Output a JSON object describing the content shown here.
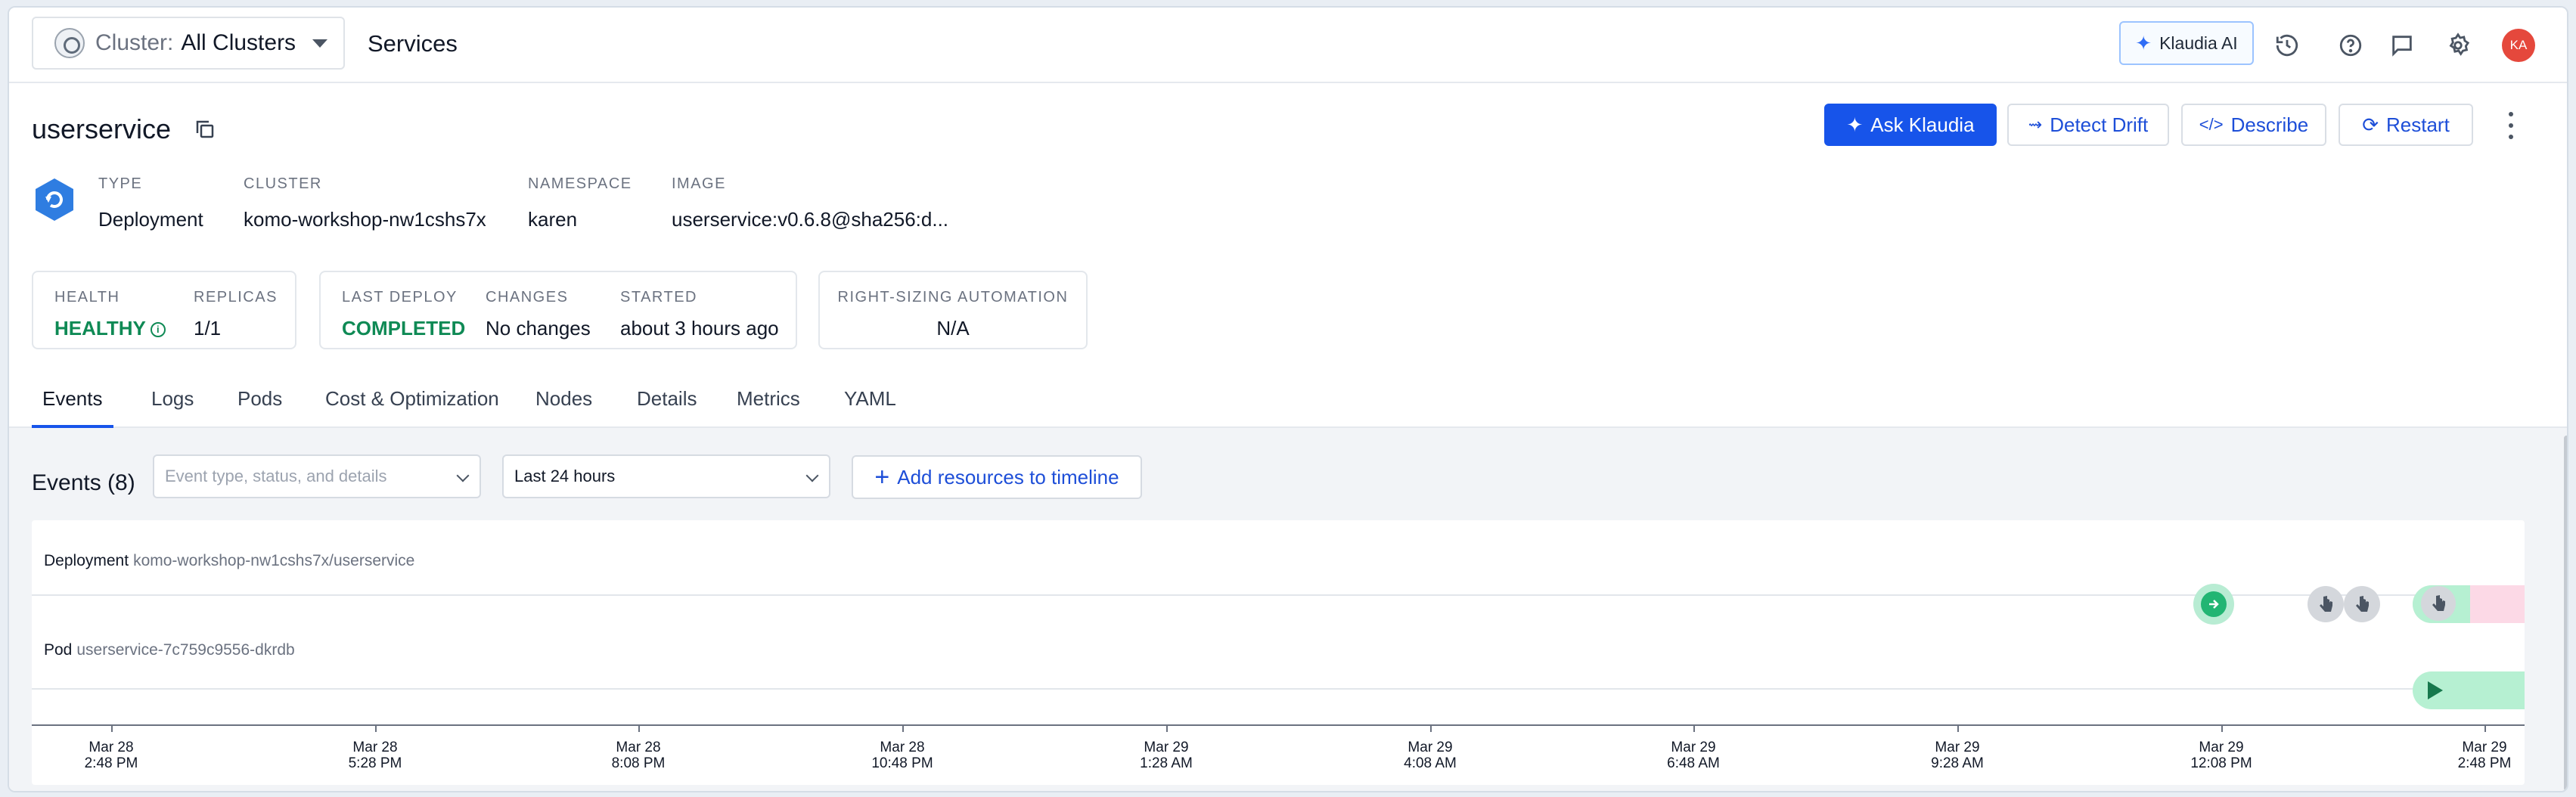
{
  "topbar": {
    "cluster_label": "Cluster:",
    "cluster_value": "All Clusters",
    "page": "Services",
    "klaudia_label": "Klaudia AI",
    "avatar_initials": "KA",
    "icons": [
      "history-icon",
      "help-icon",
      "chat-icon",
      "settings-icon"
    ]
  },
  "service": {
    "name": "userservice",
    "actions": {
      "ask": "Ask Klaudia",
      "drift": "Detect Drift",
      "describe": "Describe",
      "restart": "Restart"
    },
    "meta": {
      "type_label": "TYPE",
      "type": "Deployment",
      "cluster_label": "CLUSTER",
      "cluster": "komo-workshop-nw1cshs7x",
      "namespace_label": "NAMESPACE",
      "namespace": "karen",
      "image_label": "IMAGE",
      "image": "userservice:v0.6.8@sha256:d..."
    }
  },
  "status": {
    "health_label": "HEALTH",
    "health": "HEALTHY",
    "replicas_label": "REPLICAS",
    "replicas": "1/1",
    "last_deploy_label": "LAST DEPLOY",
    "last_deploy": "COMPLETED",
    "changes_label": "CHANGES",
    "changes": "No changes",
    "started_label": "STARTED",
    "started": "about 3 hours ago",
    "rightsizing_label": "RIGHT-SIZING AUTOMATION",
    "rightsizing": "N/A"
  },
  "tabs": [
    "Events",
    "Logs",
    "Pods",
    "Cost & Optimization",
    "Nodes",
    "Details",
    "Metrics",
    "YAML"
  ],
  "active_tab": "Events",
  "events": {
    "title": "Events (8)",
    "filter_placeholder": "Event type, status, and details",
    "time_range": "Last 24 hours",
    "add_resources": "Add resources to timeline",
    "rows": [
      {
        "kind": "Deployment",
        "name": "komo-workshop-nw1cshs7x/userservice"
      },
      {
        "kind": "Pod",
        "name": "userservice-7c759c9556-dkrdb"
      }
    ],
    "ticks": [
      {
        "date": "Mar 28",
        "time": "2:48 PM"
      },
      {
        "date": "Mar 28",
        "time": "5:28 PM"
      },
      {
        "date": "Mar 28",
        "time": "8:08 PM"
      },
      {
        "date": "Mar 28",
        "time": "10:48 PM"
      },
      {
        "date": "Mar 29",
        "time": "1:28 AM"
      },
      {
        "date": "Mar 29",
        "time": "4:08 AM"
      },
      {
        "date": "Mar 29",
        "time": "6:48 AM"
      },
      {
        "date": "Mar 29",
        "time": "9:28 AM"
      },
      {
        "date": "Mar 29",
        "time": "12:08 PM"
      },
      {
        "date": "Mar 29",
        "time": "2:48 PM"
      }
    ],
    "colors": {
      "deploy_marker": "#22b573",
      "gray_marker": "#d4d7dc",
      "pink_band": "#fcd9e6",
      "green_band": "#b6f0d2"
    }
  },
  "colors": {
    "primary": "#1754ea",
    "healthy": "#0f8a55",
    "avatar": "#e5483c"
  }
}
